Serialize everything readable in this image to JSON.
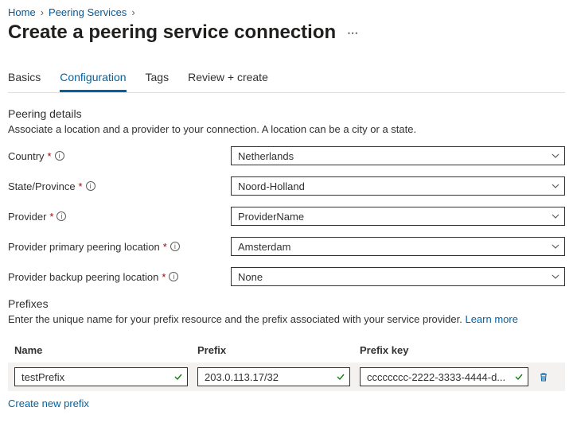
{
  "breadcrumb": {
    "home": "Home",
    "peering_services": "Peering Services"
  },
  "page_title": "Create a peering service connection",
  "tabs": {
    "basics": "Basics",
    "configuration": "Configuration",
    "tags": "Tags",
    "review_create": "Review + create"
  },
  "sections": {
    "peering_details": {
      "title": "Peering details",
      "desc": "Associate a location and a provider to your connection. A location can be a city or a state."
    },
    "prefixes": {
      "title": "Prefixes",
      "desc": "Enter the unique name for your prefix resource and the prefix associated with your service provider. ",
      "learn_more": "Learn more"
    }
  },
  "fields": {
    "country": {
      "label": "Country",
      "value": "Netherlands"
    },
    "state": {
      "label": "State/Province",
      "value": "Noord-Holland"
    },
    "provider": {
      "label": "Provider",
      "value": "ProviderName"
    },
    "primary_location": {
      "label": "Provider primary peering location",
      "value": "Amsterdam"
    },
    "backup_location": {
      "label": "Provider backup peering location",
      "value": "None"
    }
  },
  "prefix_table": {
    "headers": {
      "name": "Name",
      "prefix": "Prefix",
      "prefix_key": "Prefix key"
    },
    "rows": [
      {
        "name": "testPrefix",
        "prefix": "203.0.113.17/32",
        "prefix_key": "cccccccc-2222-3333-4444-d..."
      }
    ],
    "create_new": "Create new prefix"
  }
}
